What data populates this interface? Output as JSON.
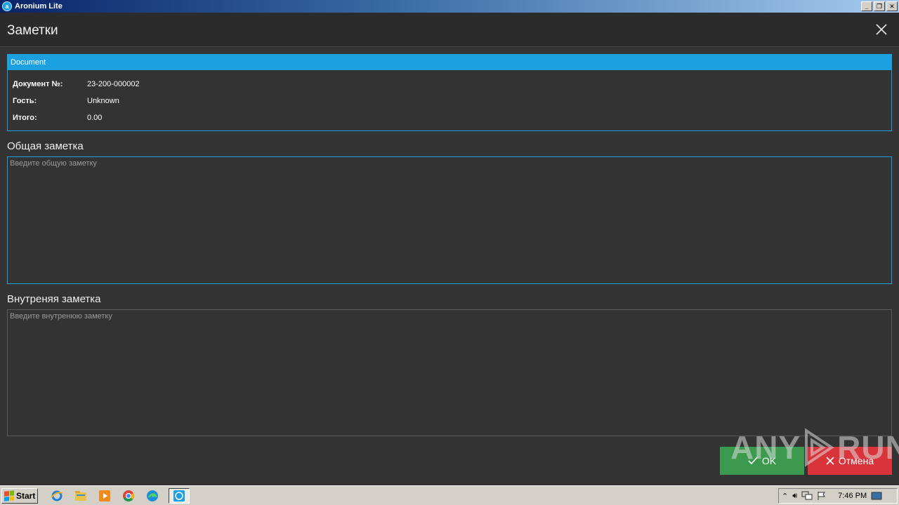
{
  "window": {
    "title": "Aronium Lite",
    "controls": [
      "_",
      "❐",
      "✕"
    ]
  },
  "dialog": {
    "title": "Заметки"
  },
  "document": {
    "header": "Document",
    "rows": [
      {
        "label": "Документ №:",
        "value": "23-200-000002"
      },
      {
        "label": "Гость:",
        "value": "Unknown"
      },
      {
        "label": "Итого:",
        "value": "0.00"
      }
    ]
  },
  "general_note": {
    "label": "Общая заметка",
    "placeholder": "Введите общую заметку",
    "value": ""
  },
  "internal_note": {
    "label": "Внутреняя заметка",
    "placeholder": "Введите внутренюю заметку",
    "value": ""
  },
  "buttons": {
    "ok": "OK",
    "cancel": "Отмена"
  },
  "watermark": {
    "left": "ANY",
    "right": "RUN"
  },
  "taskbar": {
    "start": "Start",
    "clock": "7:46 PM"
  },
  "colors": {
    "accent": "#1ba1e2",
    "ok": "#3b9a4e",
    "cancel": "#d9343a",
    "background": "#333333"
  }
}
